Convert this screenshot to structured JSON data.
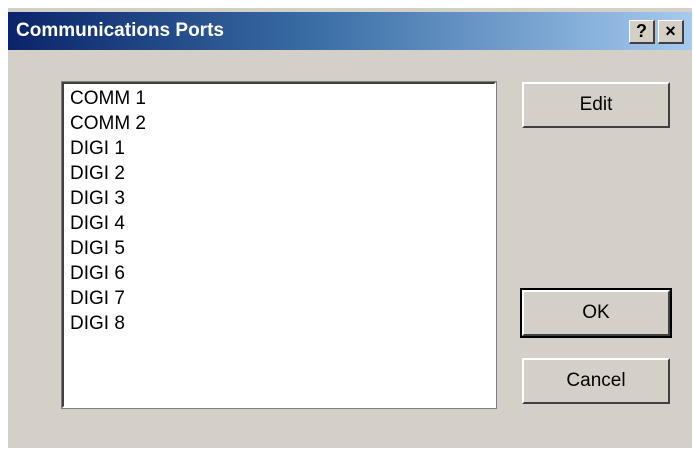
{
  "window": {
    "title": "Communications Ports",
    "help_label": "?",
    "close_label": "×"
  },
  "ports": [
    "COMM 1",
    "COMM 2",
    "DIGI 1",
    "DIGI 2",
    "DIGI 3",
    "DIGI 4",
    "DIGI 5",
    "DIGI 6",
    "DIGI 7",
    "DIGI 8"
  ],
  "buttons": {
    "edit": "Edit",
    "ok": "OK",
    "cancel": "Cancel"
  }
}
